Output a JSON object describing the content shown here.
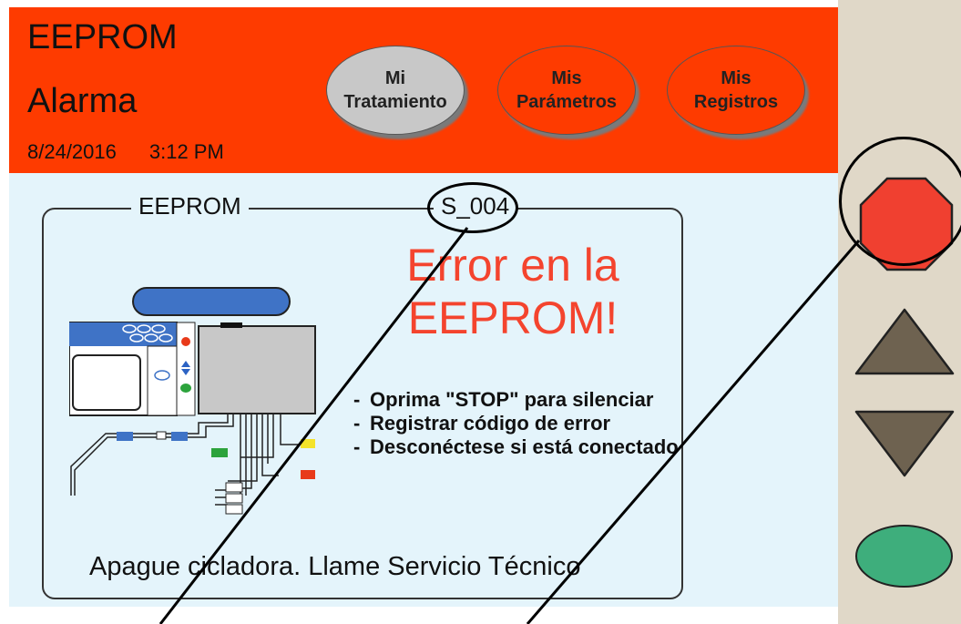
{
  "header": {
    "title_line1": "EEPROM",
    "title_line2": "Alarma",
    "date": "8/24/2016",
    "time": "3:12 PM",
    "background_color": "#fe3b00"
  },
  "nav_buttons": [
    {
      "line1": "Mi",
      "line2": "Tratamiento",
      "state": "selected"
    },
    {
      "line1": "Mis",
      "line2": "Parámetros",
      "state": "normal"
    },
    {
      "line1": "Mis",
      "line2": "Registros",
      "state": "normal"
    }
  ],
  "panel": {
    "legend_left": "EEPROM",
    "legend_code": "S_004",
    "error_title_line1": "Error en la",
    "error_title_line2": "EEPROM!",
    "error_color": "#f4442e",
    "instructions": [
      "Oprima \"STOP\" para silenciar",
      "Registrar código de error",
      "Desconéctese si está conectado"
    ],
    "footer": "Apague cicladora. Llame Servicio Técnico"
  },
  "side_controls": {
    "stop_icon": "stop-octagon-icon",
    "stop_color": "#f04030",
    "up_icon": "triangle-up-icon",
    "down_icon": "triangle-down-icon",
    "arrow_color": "#6e6250",
    "ok_icon": "green-oval-icon",
    "ok_color": "#3eae7c"
  }
}
